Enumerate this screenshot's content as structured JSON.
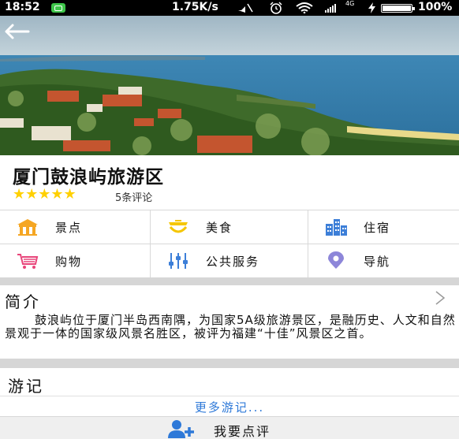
{
  "status_bar": {
    "time": "18:52",
    "net_speed": "1.75K/s",
    "network_type": "4G",
    "battery": "100%",
    "battery_level": 1.0,
    "icons": [
      "notification-icon",
      "mute-icon",
      "alarm-icon",
      "wifi-icon",
      "signal-icon",
      "battery-icon"
    ]
  },
  "header": {
    "back_icon": "back-arrow-icon"
  },
  "attraction": {
    "title": "厦门鼓浪屿旅游区",
    "stars": "★★★★★",
    "rating": 5,
    "review_count": "5条评论"
  },
  "categories": [
    {
      "label": "景点",
      "icon": "scenic-spot-icon",
      "color": "#f5a623"
    },
    {
      "label": "美食",
      "icon": "food-icon",
      "color": "#f5c600"
    },
    {
      "label": "住宿",
      "icon": "hotel-icon",
      "color": "#3d7fd8"
    },
    {
      "label": "购物",
      "icon": "shopping-cart-icon",
      "color": "#e8457a"
    },
    {
      "label": "公共服务",
      "icon": "public-service-icon",
      "color": "#3d7fd8"
    },
    {
      "label": "导航",
      "icon": "navigation-icon",
      "color": "#8d86d9"
    }
  ],
  "intro": {
    "heading": "简介",
    "text": "鼓浪屿位于厦门半岛西南隅，为国家5A级旅游景区，是融历史、人文和自然景观于一体的国家级风景名胜区，被评为福建“十佳”风景区之首。"
  },
  "travel_notes": {
    "heading": "游记",
    "more_link": "更多游记..."
  },
  "actions": {
    "write_review": "我要点评"
  },
  "colors": {
    "star": "#ffd000",
    "link": "#2e79d8",
    "separator": "#d6d6d6"
  }
}
